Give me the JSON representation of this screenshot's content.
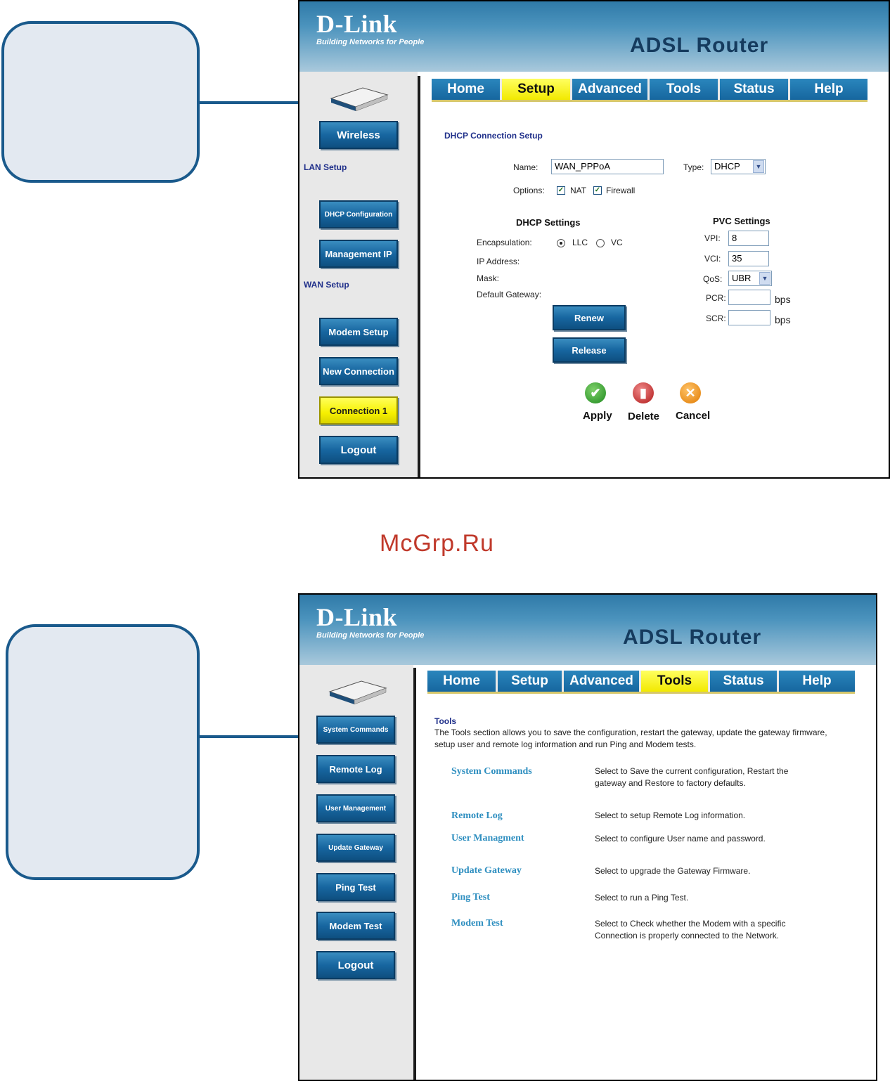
{
  "watermark": "McGrp.Ru",
  "screen1": {
    "logo": {
      "brand": "D-Link",
      "tagline": "Building Networks for People"
    },
    "product": "ADSL Router",
    "tabs": [
      {
        "label": "Home",
        "active": false
      },
      {
        "label": "Setup",
        "active": true
      },
      {
        "label": "Advanced",
        "active": false
      },
      {
        "label": "Tools",
        "active": false
      },
      {
        "label": "Status",
        "active": false
      },
      {
        "label": "Help",
        "active": false
      }
    ],
    "sidebar": {
      "wireless": "Wireless",
      "lan_setup": "LAN Setup",
      "dhcp_config": "DHCP Configuration",
      "management_ip": "Management IP",
      "wan_setup": "WAN Setup",
      "modem_setup": "Modem Setup",
      "new_connection": "New Connection",
      "connection1": "Connection 1",
      "logout": "Logout"
    },
    "form": {
      "section_title": "DHCP Connection Setup",
      "name_label": "Name:",
      "name_value": "WAN_PPPoA",
      "type_label": "Type:",
      "type_value": "DHCP",
      "options_label": "Options:",
      "nat_label": "NAT",
      "firewall_label": "Firewall",
      "dhcp_settings_title": "DHCP Settings",
      "encapsulation_label": "Encapsulation:",
      "llc_label": "LLC",
      "vc_label": "VC",
      "ip_address_label": "IP Address:",
      "mask_label": "Mask:",
      "default_gateway_label": "Default Gateway:",
      "renew": "Renew",
      "release": "Release",
      "pvc_settings_title": "PVC Settings",
      "vpi_label": "VPI:",
      "vpi_value": "8",
      "vci_label": "VCI:",
      "vci_value": "35",
      "qos_label": "QoS:",
      "qos_value": "UBR",
      "pcr_label": "PCR:",
      "scr_label": "SCR:",
      "bps": "bps",
      "apply": "Apply",
      "delete": "Delete",
      "cancel": "Cancel"
    }
  },
  "screen2": {
    "logo": {
      "brand": "D-Link",
      "tagline": "Building Networks for People"
    },
    "product": "ADSL Router",
    "tabs": [
      {
        "label": "Home",
        "active": false
      },
      {
        "label": "Setup",
        "active": false
      },
      {
        "label": "Advanced",
        "active": false
      },
      {
        "label": "Tools",
        "active": true
      },
      {
        "label": "Status",
        "active": false
      },
      {
        "label": "Help",
        "active": false
      }
    ],
    "sidebar": [
      "System Commands",
      "Remote Log",
      "User Management",
      "Update Gateway",
      "Ping Test",
      "Modem Test",
      "Logout"
    ],
    "tools_title": "Tools",
    "tools_intro": "The Tools section allows you to save the configuration, restart the gateway, update the gateway firmware, setup user and remote log information and run Ping and Modem tests.",
    "tools": [
      {
        "name": "System Commands",
        "desc": "Select to Save the current configuration, Restart the gateway and Restore to factory defaults."
      },
      {
        "name": "Remote Log",
        "desc": "Select to setup Remote Log information."
      },
      {
        "name": "User Managment",
        "desc": "Select to configure User name and password."
      },
      {
        "name": "Update Gateway",
        "desc": "Select to upgrade the Gateway Firmware."
      },
      {
        "name": "Ping Test",
        "desc": "Select to run a Ping Test."
      },
      {
        "name": "Modem Test",
        "desc": "Select to Check whether the Modem with a specific Connection is properly connected to the Network."
      }
    ]
  }
}
